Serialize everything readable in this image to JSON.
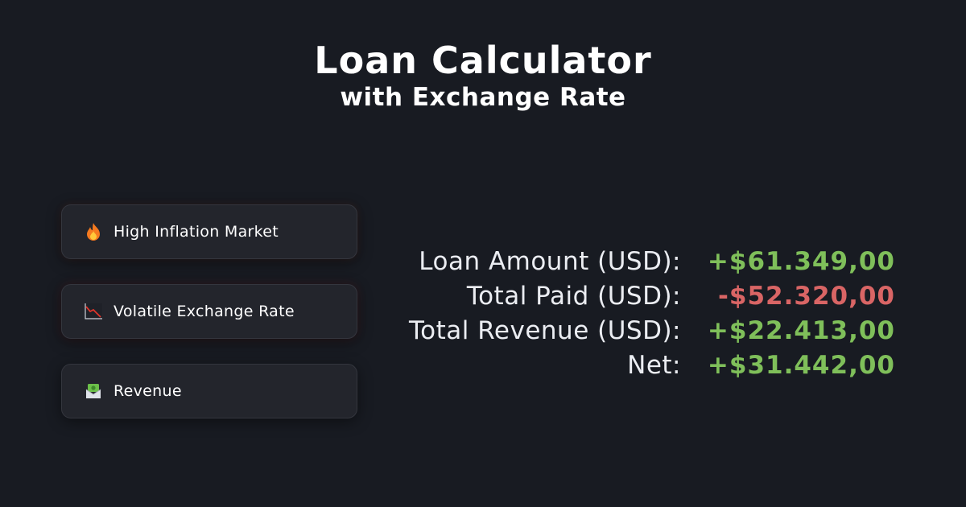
{
  "header": {
    "title": "Loan Calculator",
    "subtitle": "with Exchange Rate"
  },
  "cards": [
    {
      "label": "High Inflation Market",
      "icon": "fire-icon"
    },
    {
      "label": "Volatile Exchange Rate",
      "icon": "chart-decreasing-icon"
    },
    {
      "label": "Revenue",
      "icon": "money-envelope-icon"
    }
  ],
  "stats": [
    {
      "label": "Loan Amount (USD):",
      "value": "+$61.349,00",
      "sign": "positive"
    },
    {
      "label": "Total Paid (USD):",
      "value": "-$52.320,00",
      "sign": "negative"
    },
    {
      "label": "Total Revenue (USD):",
      "value": "+$22.413,00",
      "sign": "positive"
    },
    {
      "label": "Net:",
      "value": "+$31.442,00",
      "sign": "positive"
    }
  ],
  "colors": {
    "background": "#181b22",
    "positive": "#7fbf5a",
    "negative": "#d96565",
    "card": "#23252c"
  }
}
